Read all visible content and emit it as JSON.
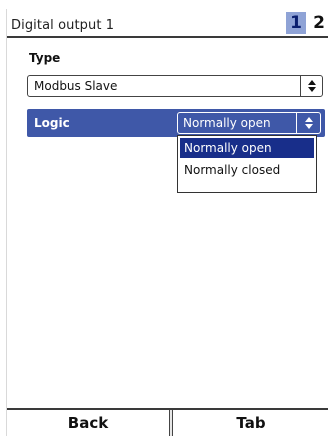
{
  "header": {
    "title": "Digital output 1",
    "pages": [
      "1",
      "2"
    ],
    "active_page": "1"
  },
  "type_field": {
    "label": "Type",
    "value": "Modbus Slave",
    "arrow_icon": "up-down-arrows-icon"
  },
  "logic_field": {
    "label": "Logic",
    "value": "Normally open",
    "arrow_icon": "up-down-arrows-icon",
    "options": [
      "Normally open",
      "Normally closed"
    ],
    "selected_option": "Normally open"
  },
  "softkeys": {
    "back_label": "Back",
    "tab_label": "Tab"
  },
  "colors": {
    "selection_row": "#3f58a8",
    "selected_option": "#182e8a",
    "active_page_bg": "#8fa3d6"
  }
}
